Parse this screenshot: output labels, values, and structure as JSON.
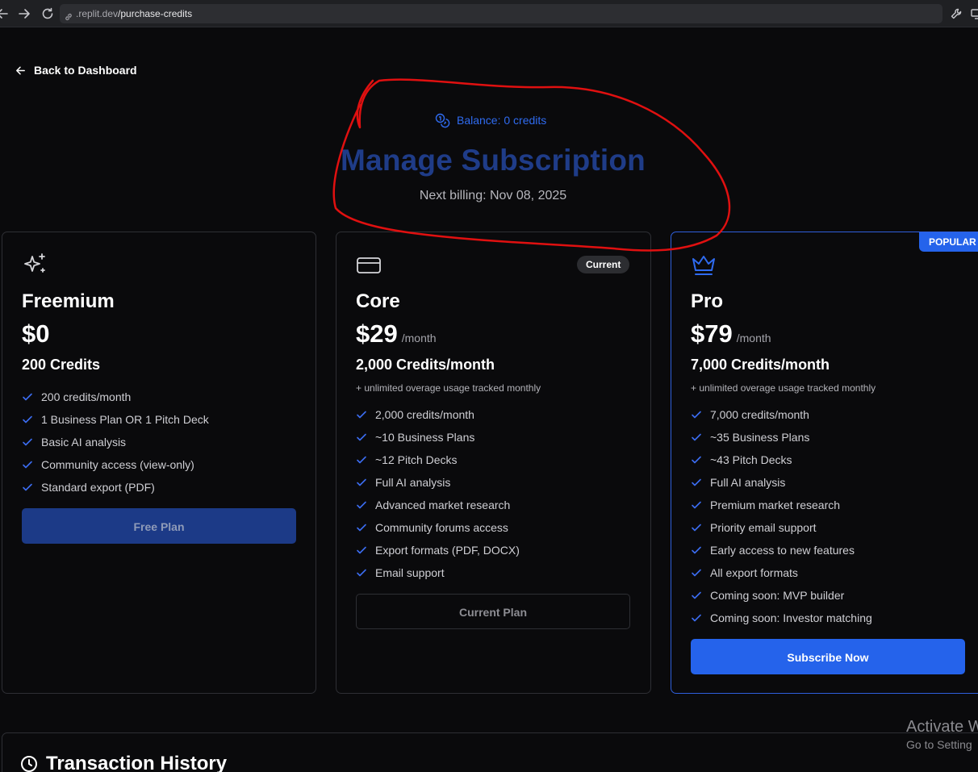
{
  "browser": {
    "url_host": ".replit.dev",
    "url_path": "/purchase-credits"
  },
  "header": {
    "back_label": "Back to Dashboard",
    "balance_text": "Balance: 0 credits",
    "title": "Manage Subscription",
    "next_billing": "Next billing: Nov 08, 2025"
  },
  "plans": [
    {
      "name": "Freemium",
      "icon": "sparkles-icon",
      "price": "$0",
      "period": "",
      "credits": "200 Credits",
      "overage": "",
      "badge": "",
      "features": [
        "200 credits/month",
        "1 Business Plan OR 1 Pitch Deck",
        "Basic AI analysis",
        "Community access (view-only)",
        "Standard export (PDF)"
      ],
      "button_label": "Free Plan"
    },
    {
      "name": "Core",
      "icon": "credit-card-icon",
      "price": "$29",
      "period": "/month",
      "credits": "2,000 Credits/month",
      "overage": "+ unlimited overage usage tracked monthly",
      "badge": "Current",
      "features": [
        "2,000 credits/month",
        "~10 Business Plans",
        "~12 Pitch Decks",
        "Full AI analysis",
        "Advanced market research",
        "Community forums access",
        "Export formats (PDF, DOCX)",
        "Email support"
      ],
      "button_label": "Current Plan"
    },
    {
      "name": "Pro",
      "icon": "crown-icon",
      "price": "$79",
      "period": "/month",
      "credits": "7,000 Credits/month",
      "overage": "+ unlimited overage usage tracked monthly",
      "badge": "POPULAR",
      "features": [
        "7,000 credits/month",
        "~35 Business Plans",
        "~43 Pitch Decks",
        "Full AI analysis",
        "Premium market research",
        "Priority email support",
        "Early access to new features",
        "All export formats",
        "Coming soon: MVP builder",
        "Coming soon: Investor matching"
      ],
      "button_label": "Subscribe Now"
    }
  ],
  "history": {
    "title": "Transaction History"
  },
  "watermark": {
    "line1": "Activate W",
    "line2": "Go to Setting"
  },
  "colors": {
    "accent": "#2563eb",
    "title": "#1f3c88",
    "check": "#3b6cf0",
    "annotation": "#e01010"
  }
}
